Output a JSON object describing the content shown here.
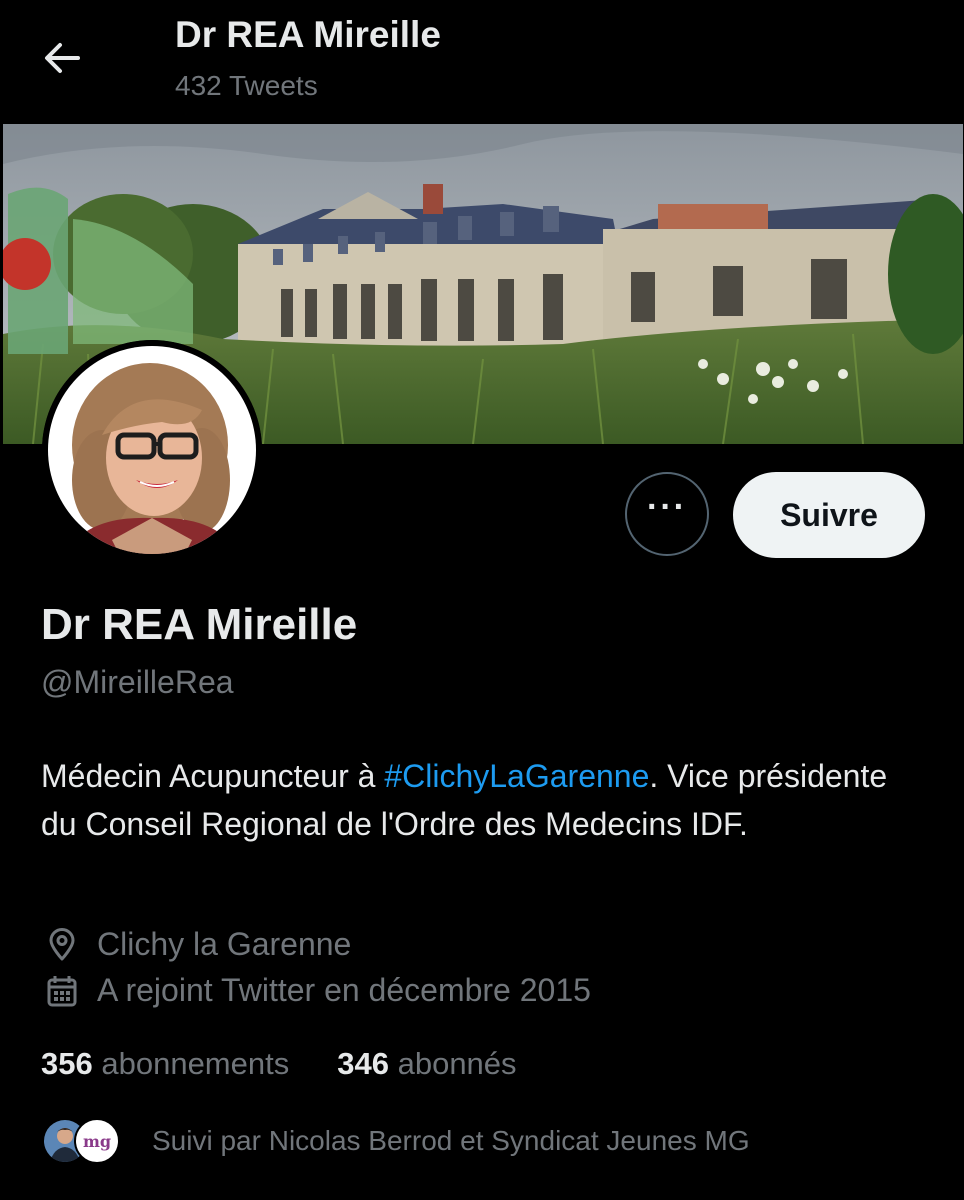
{
  "header": {
    "title": "Dr REA Mireille",
    "tweet_count": "432 Tweets"
  },
  "profile": {
    "name": "Dr REA Mireille",
    "handle": "@MireilleRea",
    "bio_part1": "Médecin Acupuncteur à ",
    "bio_hashtag": "#ClichyLaGarenne",
    "bio_part2": ". Vice présidente du Conseil Regional de l'Ordre des Medecins IDF.",
    "location": "Clichy la Garenne",
    "joined": "A rejoint Twitter en décembre 2015",
    "following_count": "356",
    "following_label": "abonnements",
    "followers_count": "346",
    "followers_label": "abonnés",
    "followed_by": "Suivi par Nicolas Berrod et Syndicat Jeunes MG",
    "followed_by_badge_text": "mg"
  },
  "actions": {
    "more_label": "···",
    "follow_label": "Suivre"
  },
  "colors": {
    "background": "#000000",
    "text_primary": "#e7e9ea",
    "text_secondary": "#71767b",
    "link": "#1d9bf0",
    "follow_bg": "#eff3f4"
  },
  "icons": [
    "back-arrow-icon",
    "location-pin-icon",
    "calendar-icon"
  ]
}
